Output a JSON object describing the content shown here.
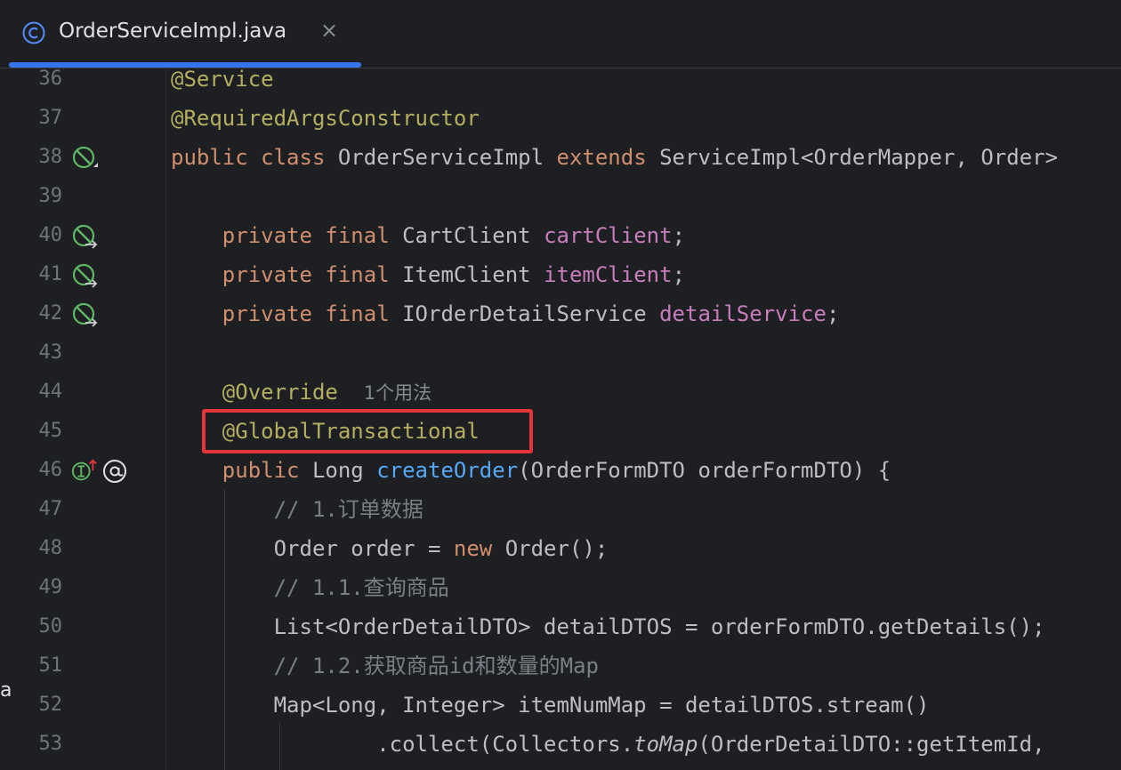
{
  "tab": {
    "title": "OrderServiceImpl.java",
    "close_glyph": "×",
    "icon": "java-class-icon",
    "accent": "#3574f0"
  },
  "left_edge_fragment": "a",
  "colors": {
    "keyword": "#cf8e6d",
    "annotation": "#b3ae60",
    "field": "#c77dbb",
    "method_decl": "#56a8f5",
    "comment": "#7a7e85",
    "text": "#bcbec4",
    "line_number": "#6f737a",
    "highlight_box": "#e5353b"
  },
  "code_lines": [
    {
      "num": "36"
    },
    {
      "num": "37"
    },
    {
      "num": "38",
      "gutter_icon": "spring-bean-icon"
    },
    {
      "num": "39"
    },
    {
      "num": "40",
      "gutter_icon": "spring-bean-navigate-icon"
    },
    {
      "num": "41",
      "gutter_icon": "spring-bean-navigate-icon"
    },
    {
      "num": "42",
      "gutter_icon": "spring-bean-navigate-icon"
    },
    {
      "num": "43"
    },
    {
      "num": "44"
    },
    {
      "num": "45"
    },
    {
      "num": "46",
      "gutter_icon": "implements-up-icon",
      "gutter_icon_2": "at-symbol-icon"
    },
    {
      "num": "47"
    },
    {
      "num": "48"
    },
    {
      "num": "49"
    },
    {
      "num": "50"
    },
    {
      "num": "51"
    },
    {
      "num": "52"
    },
    {
      "num": "53"
    }
  ],
  "code": {
    "l36_ann": "@Service",
    "l37_ann": "@RequiredArgsConstructor",
    "l38_kw1": "public",
    "l38_kw2": "class",
    "l38_name": "OrderServiceImpl",
    "l38_kw3": "extends",
    "l38_rest": "ServiceImpl<OrderMapper, Order>",
    "l40_kw1": "private",
    "l40_kw2": "final",
    "l40_type": "CartClient",
    "l40_field": "cartClient",
    "l40_end": ";",
    "l41_kw1": "private",
    "l41_kw2": "final",
    "l41_type": "ItemClient",
    "l41_field": "itemClient",
    "l41_end": ";",
    "l42_kw1": "private",
    "l42_kw2": "final",
    "l42_type": "IOrderDetailService",
    "l42_field": "detailService",
    "l42_end": ";",
    "l44_ann": "@Override",
    "l44_hint": "1个用法",
    "l45_ann": "@GlobalTransactional",
    "l46_kw1": "public",
    "l46_type": "Long",
    "l46_method": "createOrder",
    "l46_params": "(OrderFormDTO orderFormDTO) {",
    "l47_comment": "// 1.订单数据",
    "l48_a": "Order order = ",
    "l48_kw": "new",
    "l48_b": " Order();",
    "l49_comment": "// 1.1.查询商品",
    "l50_text": "List<OrderDetailDTO> detailDTOS = orderFormDTO.getDetails();",
    "l51_comment": "// 1.2.获取商品id和数量的Map",
    "l52_text": "Map<Long, Integer> itemNumMap = detailDTOS.stream()",
    "l53_a": ".collect(Collectors.",
    "l53_italic": "toMap",
    "l53_b": "(OrderDetailDTO::getItemId,"
  }
}
